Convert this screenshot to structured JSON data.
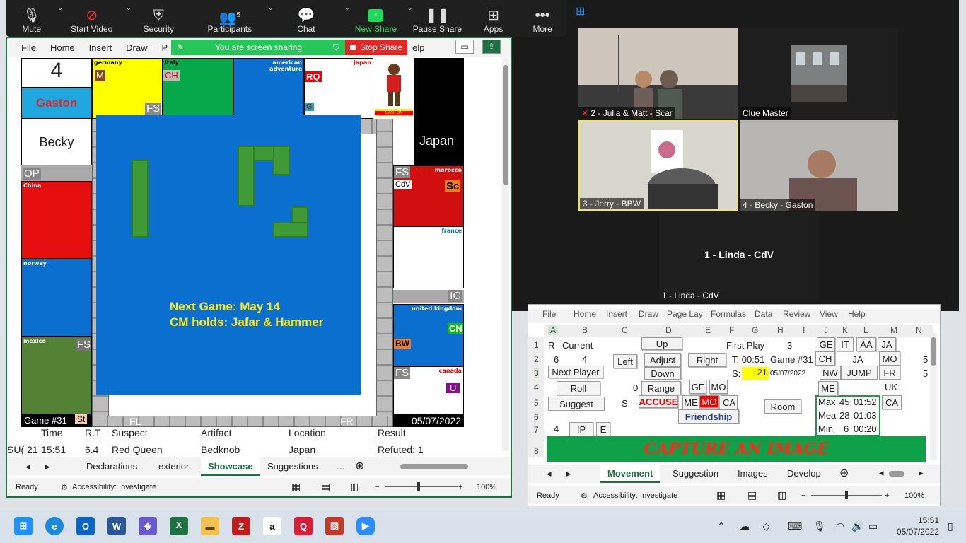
{
  "zoom_toolbar": {
    "items": [
      {
        "label": "Mute",
        "icon": "mic-icon"
      },
      {
        "label": "Start Video",
        "icon": "video-off-icon"
      },
      {
        "label": "Security",
        "icon": "shield-icon"
      },
      {
        "label": "Participants",
        "icon": "participants-icon",
        "count": "5"
      },
      {
        "label": "Chat",
        "icon": "chat-icon"
      },
      {
        "label": "New Share",
        "icon": "share-up-icon"
      },
      {
        "label": "Pause Share",
        "icon": "pause-icon"
      },
      {
        "label": "Apps",
        "icon": "apps-icon"
      },
      {
        "label": "More",
        "icon": "more-icon"
      }
    ]
  },
  "share_bar": {
    "status": "You are screen sharing",
    "stop": "Stop Share"
  },
  "excel_left": {
    "menu": [
      "File",
      "Home",
      "Insert",
      "Draw",
      "P",
      "elp"
    ],
    "board": {
      "player_number": "4",
      "player_name": "Gaston",
      "current": "Becky",
      "countries": [
        "germany",
        "italy",
        "american adventure",
        "japan",
        "morocco",
        "france",
        "united kingdom",
        "canada",
        "China",
        "norway",
        "mexico"
      ],
      "tags": {
        "germany": "M",
        "italy": "CH",
        "japan_top": "RQ",
        "japan_g": "G",
        "morocco": "Sc",
        "morocco2": "CdV",
        "uk": "CN",
        "uk2": "BW",
        "canada": "U",
        "gaston_card": "GASTON"
      },
      "gates": {
        "FS_top": "FS",
        "Japan": "Japan",
        "FS_right1": "FS",
        "OP": "OP",
        "IG": "IG",
        "FS_right2": "FS",
        "FS_left": "FS",
        "FL": "FL",
        "FR": "FR",
        "St": "St"
      },
      "game": "Game #31",
      "date": "05/07/2022",
      "notice": [
        "Next Game: May 14",
        "CM holds: Jafar & Hammer"
      ]
    },
    "table": {
      "headers": [
        "Time",
        "R.T",
        "Suspect",
        "Artifact",
        "Location",
        "Result"
      ],
      "row": [
        "SU( 21",
        "15:51",
        "6.4",
        "Red Queen",
        "Bedknob",
        "Japan",
        "Refuted: 1"
      ]
    },
    "tabs": [
      "Declarations",
      "exterior",
      "Showcase",
      "Suggestions",
      "..."
    ],
    "active_tab": "Showcase",
    "status": {
      "ready": "Ready",
      "accessibility": "Accessibility: Investigate",
      "zoom": "100%"
    }
  },
  "gallery": {
    "participants": [
      {
        "label": "2 - Julia & Matt - Scar",
        "muted": true
      },
      {
        "label": "Clue Master"
      },
      {
        "label": "3 - Jerry - BBW"
      },
      {
        "label": "4 - Becky - Gaston"
      },
      {
        "label": "1 - Linda - CdV",
        "name_center": "1 - Linda - CdV"
      }
    ]
  },
  "excel_right": {
    "menu": [
      "File",
      "Home",
      "Insert",
      "Draw",
      "Page Lay",
      "Formulas",
      "Data",
      "Review",
      "View",
      "Help"
    ],
    "columns": [
      "A",
      "B",
      "C",
      "D",
      "E",
      "F",
      "G",
      "H",
      "I",
      "J",
      "K",
      "L",
      "M",
      "N"
    ],
    "rows": [
      "1",
      "2",
      "3",
      "4",
      "5",
      "6",
      "7",
      "8"
    ],
    "cells": {
      "r": "R",
      "current": "Current",
      "six": "6",
      "four": "4",
      "zero": "0",
      "s": "S",
      "four2": "4",
      "first_play": "First Play",
      "first_play_val": "3",
      "t": "T: 00:51",
      "game": "Game #31",
      "s_label": "S:",
      "s_val": "21",
      "date": "05/07/2022",
      "stats": [
        [
          "Max",
          "45",
          "01:52"
        ],
        [
          "Mea",
          "28",
          "01:03"
        ],
        [
          "Min",
          "6",
          "00:20"
        ]
      ],
      "five": "5",
      "five2": "5"
    },
    "buttons": {
      "up": "Up",
      "left": "Left",
      "adjust": "Adjust",
      "right": "Right",
      "down": "Down",
      "next_player": "Next Player",
      "roll": "Roll",
      "range": "Range",
      "suggest": "Suggest",
      "accuse": "ACCUSE",
      "ge": "GE",
      "mo": "MO",
      "me": "ME",
      "mo_red": "MO",
      "ca": "CA",
      "friendship": "Friendship",
      "room": "Room",
      "ip": "IP",
      "e": "E",
      "ge2": "GE",
      "it": "IT",
      "aa": "AA",
      "ja": "JA",
      "ch": "CH",
      "ja2": "JA",
      "mo2": "MO",
      "nw": "NW",
      "jump": "JUMP",
      "fr": "FR",
      "uk": "UK",
      "me2": "ME",
      "ca2": "CA"
    },
    "capture": "CAPTURE AN IMAGE",
    "tabs": [
      "Movement",
      "Suggestion",
      "Images",
      "Develop"
    ],
    "active_tab": "Movement",
    "status": {
      "ready": "Ready",
      "accessibility": "Accessibility: Investigate",
      "zoom": "100%"
    }
  },
  "taskbar": {
    "time": "15:51",
    "date": "05/07/2022"
  }
}
